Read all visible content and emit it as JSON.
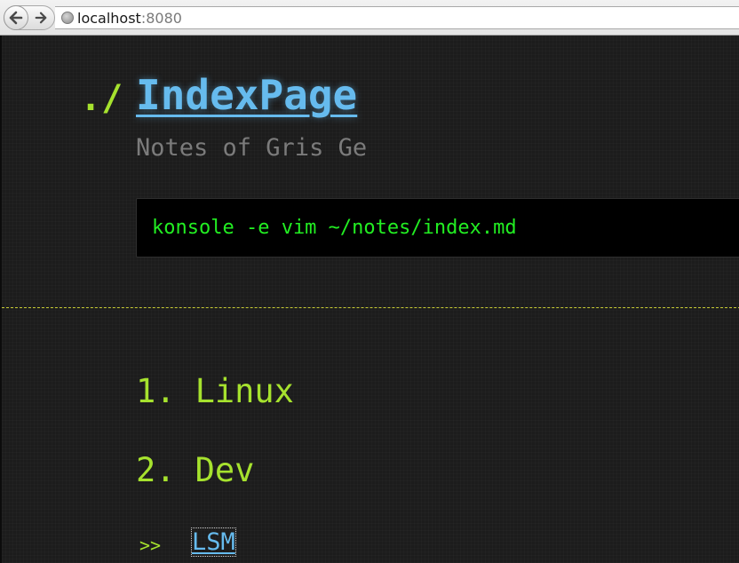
{
  "browser": {
    "url_host": "localhost",
    "url_port": ":8080"
  },
  "page": {
    "title_prefix": "./",
    "title": "IndexPage",
    "subtitle": "Notes of Gris Ge",
    "command": "konsole -e vim ~/notes/index.md",
    "toc": [
      {
        "number": "1.",
        "label": "Linux"
      },
      {
        "number": "2.",
        "label": "Dev"
      }
    ],
    "sub_marker": ">>",
    "sub_link": "LSM"
  },
  "colors": {
    "background": "#1c1c1c",
    "accent_green": "#a6e22e",
    "link_blue": "#66bbee",
    "command_green": "#22ee22",
    "subtitle_gray": "#7b7b7b",
    "divider_yellow": "#c8cc33"
  },
  "icons": {
    "back": "back-arrow-icon",
    "forward": "forward-arrow-icon",
    "site": "globe-icon"
  }
}
